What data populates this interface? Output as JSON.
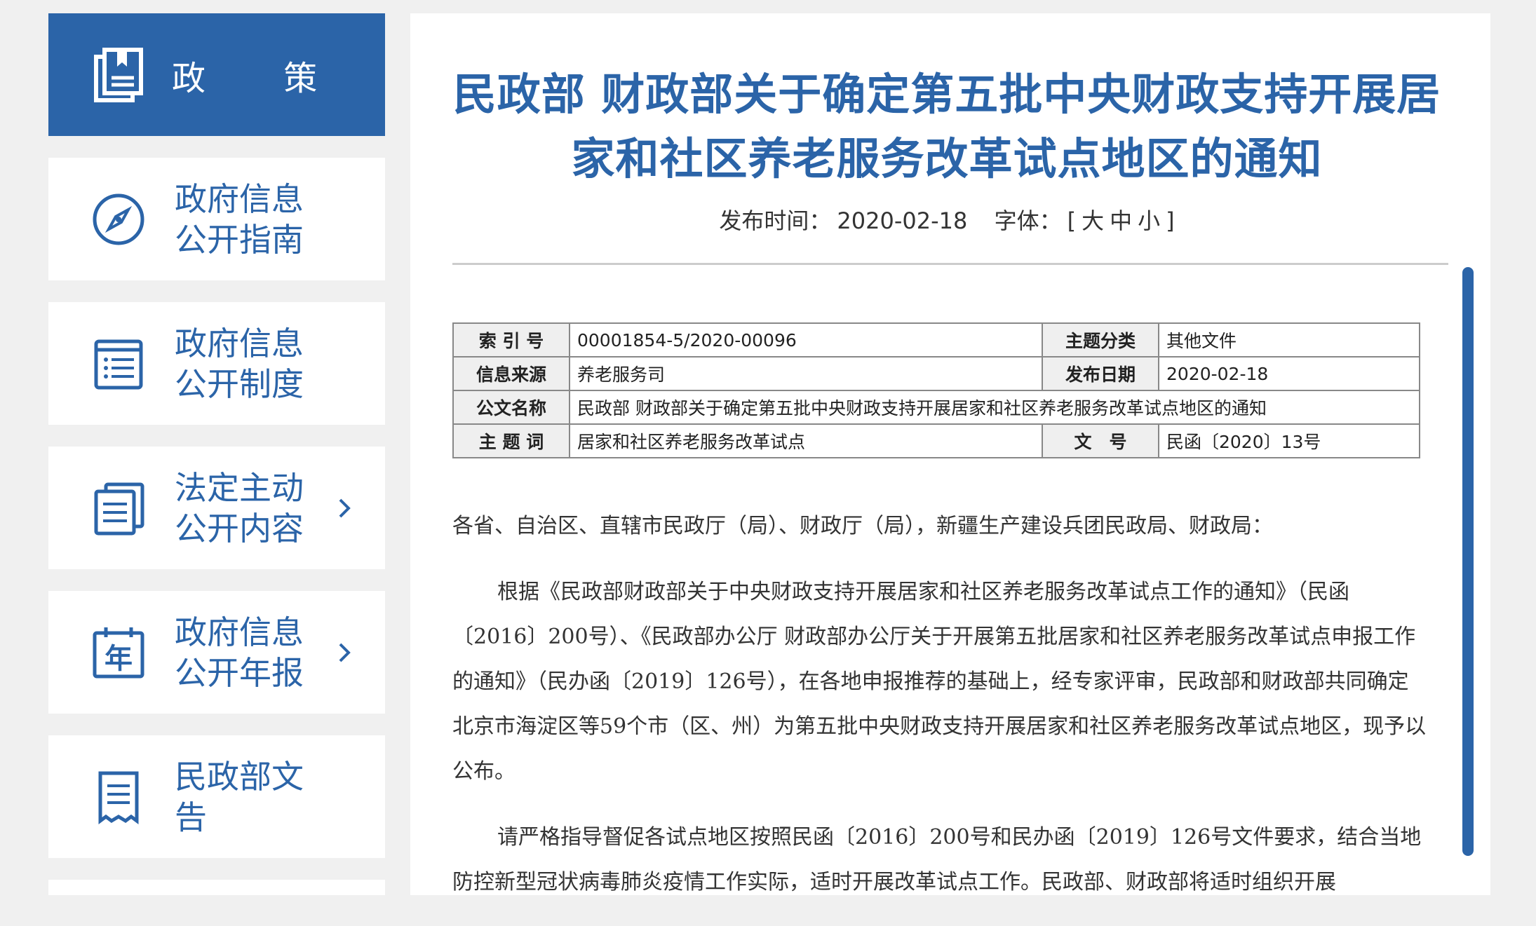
{
  "sidebar": {
    "header_label": "政 策",
    "items": [
      {
        "label": "政府信息公开指南",
        "icon": "compass-icon"
      },
      {
        "label": "政府信息公开制度",
        "icon": "list-document-icon"
      },
      {
        "label": "法定主动公开内容",
        "icon": "stacked-documents-icon"
      },
      {
        "label": "政府信息公开年报",
        "icon": "calendar-year-icon",
        "icon_text": "年"
      },
      {
        "label": "民政部文告",
        "icon": "receipt-document-icon"
      }
    ]
  },
  "article": {
    "title": "民政部 财政部关于确定第五批中央财政支持开展居家和社区养老服务改革试点地区的通知",
    "publish_label": "发布时间：",
    "publish_date": "2020-02-18",
    "font_label": "字体：",
    "font_open": "[",
    "font_large": "大",
    "font_medium": "中",
    "font_small": "小",
    "font_close": "]"
  },
  "info_table": {
    "index_label": "索 引 号",
    "index_value": "00001854-5/2020-00096",
    "category_label": "主题分类",
    "category_value": "其他文件",
    "source_label": "信息来源",
    "source_value": "养老服务司",
    "date_label": "发布日期",
    "date_value": "2020-02-18",
    "name_label": "公文名称",
    "name_value": "民政部 财政部关于确定第五批中央财政支持开展居家和社区养老服务改革试点地区的通知",
    "keyword_label": "主 题 词",
    "keyword_value": "居家和社区养老服务改革试点",
    "docno_label": "文　号",
    "docno_value": "民函〔2020〕13号"
  },
  "body": {
    "salutation": "各省、自治区、直辖市民政厅（局）、财政厅（局），新疆生产建设兵团民政局、财政局：",
    "para1": "根据《民政部财政部关于中央财政支持开展居家和社区养老服务改革试点工作的通知》（民函〔2016〕200号）、《民政部办公厅 财政部办公厅关于开展第五批居家和社区养老服务改革试点申报工作的通知》（民办函〔2019〕126号），在各地申报推荐的基础上，经专家评审，民政部和财政部共同确定北京市海淀区等59个市（区、州）为第五批中央财政支持开展居家和社区养老服务改革试点地区，现予以公布。",
    "para2": "请严格指导督促各试点地区按照民函〔2016〕200号和民办函〔2019〕126号文件要求，结合当地防控新型冠状病毒肺炎疫情工作实际，适时开展改革试点工作。民政部、财政部将适时组织开展"
  }
}
